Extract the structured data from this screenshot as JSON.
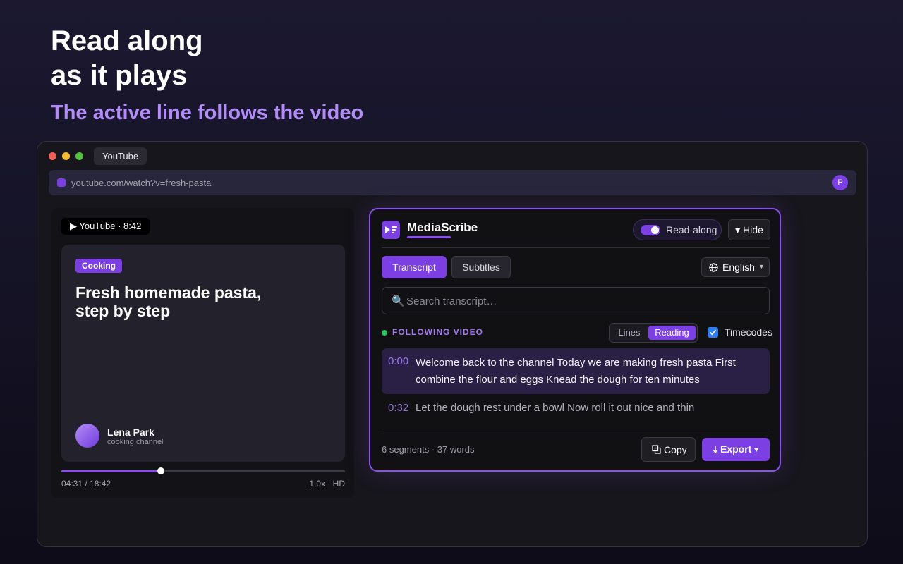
{
  "hero": {
    "title_line1": "Read along",
    "title_line2": "as it plays",
    "subtitle": "The active line follows the video"
  },
  "browser": {
    "tab_label": "YouTube",
    "url": "youtube.com/watch?v=fresh-pasta",
    "profile_initial": "P"
  },
  "video": {
    "chip": "▶ YouTube · 8:42",
    "category": "Cooking",
    "title_line1": "Fresh homemade pasta,",
    "title_line2": "step by step",
    "creator_name": "Lena Park",
    "creator_sub": "cooking channel",
    "time": "04:31 / 18:42",
    "quality": "1.0x · HD",
    "progress_fraction": 0.35
  },
  "extension": {
    "brand": "MediaScribe",
    "readalong_label": "Read-along",
    "readalong_on": true,
    "hide_label": "▾ Hide",
    "tabs": [
      {
        "label": "Transcript",
        "active": true
      },
      {
        "label": "Subtitles",
        "active": false
      }
    ],
    "language": "English",
    "search_placeholder": "Search transcript…",
    "status": "FOLLOWING VIDEO",
    "view_modes": {
      "lines": "Lines",
      "reading": "Reading",
      "selected": "Reading"
    },
    "timecodes_label": "Timecodes",
    "timecodes_checked": true,
    "segments": [
      {
        "time": "0:00",
        "text": "Welcome back to the channel Today we are making fresh pasta First combine the flour and eggs Knead the dough for ten minutes",
        "active": true
      },
      {
        "time": "0:32",
        "text": "Let the dough rest under a bowl Now roll it out nice and thin",
        "active": false
      }
    ],
    "stats": "6 segments · 37 words",
    "copy_label": "Copy",
    "export_label": "⤓ Export ▾"
  },
  "colors": {
    "accent": "#7b3fe4",
    "accent_light": "#b28cf7",
    "status_green": "#22c55e",
    "checkbox_blue": "#2f7df0"
  },
  "icons": [
    "play-icon",
    "globe-icon",
    "search-icon",
    "copy-icon",
    "download-icon",
    "chevron-down-icon",
    "brand-logo-icon"
  ]
}
